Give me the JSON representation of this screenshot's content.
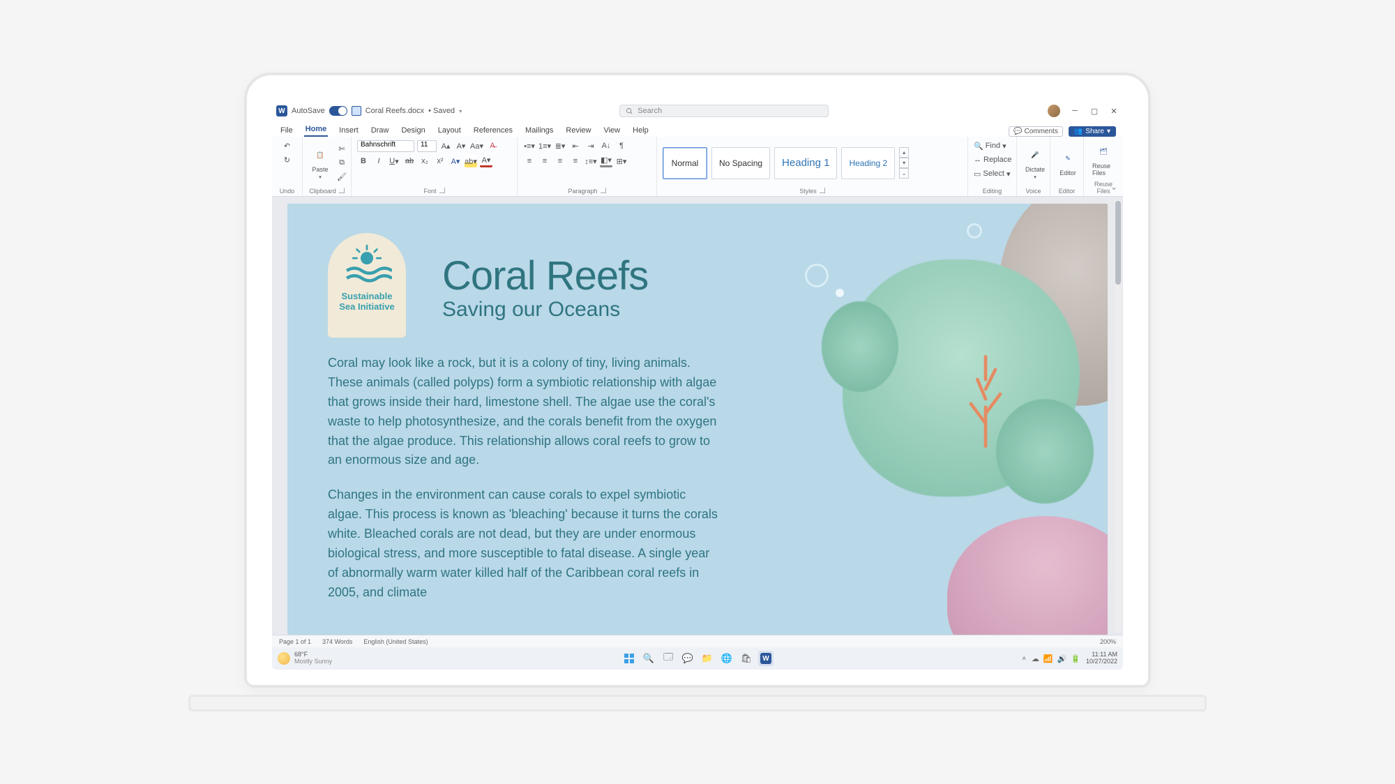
{
  "titlebar": {
    "autosave_label": "AutoSave",
    "autosave_state": "On",
    "doc_name": "Coral Reefs.docx",
    "saved_text": "• Saved ",
    "search_placeholder": "Search"
  },
  "tabs": [
    "File",
    "Home",
    "Insert",
    "Draw",
    "Design",
    "Layout",
    "References",
    "Mailings",
    "Review",
    "View",
    "Help"
  ],
  "active_tab": "Home",
  "tabs_right": {
    "comments": "Comments",
    "share": "Share"
  },
  "ribbon": {
    "undo_label": "Undo",
    "clipboard": {
      "paste": "Paste",
      "label": "Clipboard"
    },
    "font": {
      "name": "Bahnschrift",
      "size": "11",
      "label": "Font"
    },
    "paragraph": {
      "label": "Paragraph"
    },
    "styles": {
      "label": "Styles",
      "items": [
        "Normal",
        "No Spacing",
        "Heading 1",
        "Heading 2"
      ]
    },
    "editing": {
      "find": "Find",
      "replace": "Replace",
      "select": "Select",
      "label": "Editing"
    },
    "voice": {
      "dictate": "Dictate",
      "label": "Voice"
    },
    "editor": {
      "editor": "Editor",
      "label": "Editor"
    },
    "reuse": {
      "reuse": "Reuse Files",
      "label": "Reuse Files"
    }
  },
  "document": {
    "logo_line1": "Sustainable",
    "logo_line2": "Sea Initiative",
    "title": "Coral Reefs",
    "subtitle": "Saving our Oceans",
    "para1": "Coral may look like a rock, but it is a colony of tiny, living animals. These animals (called polyps) form a symbiotic relationship with algae that grows inside their hard, limestone shell. The algae use the coral's waste to help photosynthesize, and the corals benefit from the oxygen that the algae produce. This relationship allows coral reefs to grow to an enormous size and age.",
    "para2": "Changes in the environment can cause corals to expel symbiotic algae. This process is known as 'bleaching' because it turns the corals white. Bleached corals are not dead, but they are under enormous biological stress, and more susceptible to fatal disease. A single year of abnormally warm water killed half of the Caribbean coral reefs in 2005, and climate"
  },
  "status": {
    "page": "Page 1 of 1",
    "words": "374 Words",
    "lang": "English (United States)",
    "zoom": "200%"
  },
  "taskbar": {
    "temp": "68°F",
    "cond": "Mostly Sunny",
    "time": "11:11 AM",
    "date": "10/27/2022"
  }
}
